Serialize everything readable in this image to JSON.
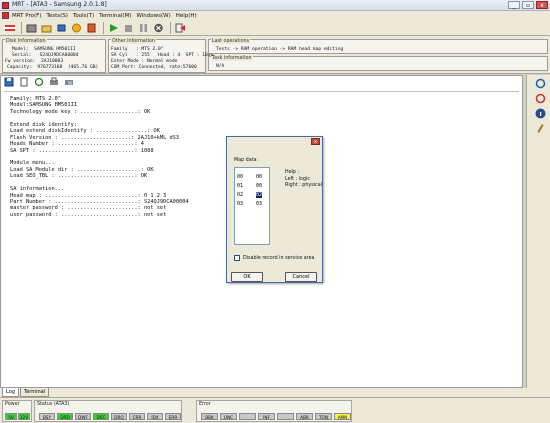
{
  "window": {
    "title": "MRT - [ATA3 - Samsung 2.0.1.8]",
    "controls": [
      "_",
      "▫",
      "x"
    ]
  },
  "menu": [
    "MRT Pro(F)",
    "Tests(S)",
    "Tools(T)",
    "Terminal(M)",
    "Windows(W)",
    "Help(H)"
  ],
  "toolbar": {
    "buttons": [
      "exit-icon",
      "drive-icon",
      "open-icon",
      "chip-icon",
      "star-icon",
      "plugin-icon",
      "play-icon",
      "stop-icon",
      "pause-icon",
      "cancel-icon",
      "export-icon"
    ]
  },
  "disk_info": {
    "title": "Disk Information",
    "rows": [
      "Model:  SAMSUNG HM501II",
      "Serial:   S24QJ9DCA00004",
      "Fw version:  2AJ10003",
      "Capacity:  976773168  (465.76 GB)"
    ]
  },
  "other_info": {
    "title": "Other Information",
    "rows": [
      "Family   : MTS 2.0\"",
      "SA Cyl   : 255   Head : 4  SPT : 1088",
      "Enter Mode : Normal mode",
      "COM Port: Connected, rate:57600"
    ]
  },
  "last_operations": {
    "title": "Last operations",
    "text": "Tests -> RAM operation -> RAM head map editing"
  },
  "task_info": {
    "title": "Task information",
    "text": "N/A"
  },
  "log_lines": [
    "Family: MTS 2.0\"",
    "Model:SAMSUNG HM501II",
    "Technology mode key : ..................: OK",
    "",
    "Extend disk identify:",
    "Load extend diskIdentify : ................: OK",
    "Flash Version : ......................: 2AJ10+kML dS3",
    "Heads Number : ........................: 4",
    "SA SPT : ..............................: 1088",
    "",
    "Module menu...",
    "Load SA Module dir : ....................: OK",
    "Load SEO_TBL : ........................: OK",
    "",
    "SA information...",
    "Head map : .............................: 0 1 2 3",
    "Part Number : ..........................: S24QJ9DCA00004",
    "master password : ......................: not set",
    "user password : ........................: not set"
  ],
  "dialog": {
    "close": "x",
    "map_label": "Map data:",
    "map_rows": [
      [
        "00",
        "00"
      ],
      [
        "01",
        "00"
      ],
      [
        "02",
        "02"
      ],
      [
        "03",
        "03"
      ]
    ],
    "help_title": "Help :",
    "help_lines": [
      "Left : logic",
      "Right : physical"
    ],
    "disable_label": "Disable record in service area",
    "ok": "OK",
    "cancel": "Cancel"
  },
  "tabs": [
    "Log",
    "Terminal"
  ],
  "status": {
    "power_title": "Power",
    "power_values": [
      "5V",
      "12V"
    ],
    "status_title": "Status (ATA3)",
    "status_values": [
      "BSY",
      "DRD",
      "DWF",
      "DSC",
      "DRQ",
      "CRR",
      "IDX",
      "ERR"
    ],
    "error_title": "Error",
    "error_values": [
      "BBK",
      "UNC",
      "",
      "INF",
      "",
      "ABR",
      "TON",
      "AMN"
    ]
  },
  "colors": {
    "green_on": "#37d137",
    "gray_off": "#c8c8c8",
    "yellow_on": "#f2f24a"
  }
}
